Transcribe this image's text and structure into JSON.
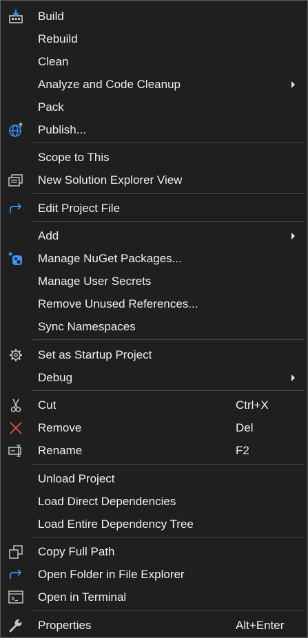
{
  "menu": {
    "items": [
      {
        "label": "Build",
        "icon": "build-icon"
      },
      {
        "label": "Rebuild"
      },
      {
        "label": "Clean"
      },
      {
        "label": "Analyze and Code Cleanup",
        "submenu": true
      },
      {
        "label": "Pack"
      },
      {
        "label": "Publish...",
        "icon": "publish-globe-icon"
      },
      {
        "label": "Scope to This"
      },
      {
        "label": "New Solution Explorer View",
        "icon": "new-view-icon"
      },
      {
        "label": "Edit Project File",
        "icon": "edit-arrow-icon"
      },
      {
        "label": "Add",
        "submenu": true
      },
      {
        "label": "Manage NuGet Packages...",
        "icon": "nuget-icon"
      },
      {
        "label": "Manage User Secrets"
      },
      {
        "label": "Remove Unused References..."
      },
      {
        "label": "Sync Namespaces"
      },
      {
        "label": "Set as Startup Project",
        "icon": "gear-icon"
      },
      {
        "label": "Debug",
        "submenu": true
      },
      {
        "label": "Cut",
        "shortcut": "Ctrl+X",
        "icon": "scissors-icon"
      },
      {
        "label": "Remove",
        "shortcut": "Del",
        "icon": "remove-x-icon"
      },
      {
        "label": "Rename",
        "shortcut": "F2",
        "icon": "rename-icon"
      },
      {
        "label": "Unload Project"
      },
      {
        "label": "Load Direct Dependencies"
      },
      {
        "label": "Load Entire Dependency Tree"
      },
      {
        "label": "Copy Full Path",
        "icon": "copy-icon"
      },
      {
        "label": "Open Folder in File Explorer",
        "icon": "open-folder-arrow-icon"
      },
      {
        "label": "Open in Terminal",
        "icon": "terminal-icon"
      },
      {
        "label": "Properties",
        "shortcut": "Alt+Enter",
        "icon": "wrench-icon"
      }
    ]
  },
  "colors": {
    "background": "#1f1f1f",
    "border": "#5a5a5a",
    "separator": "#4a4a4a",
    "text": "#f0f0f0",
    "icon_blue": "#3794ff",
    "icon_red": "#f14c4c",
    "icon_gray": "#c5c5c5"
  }
}
